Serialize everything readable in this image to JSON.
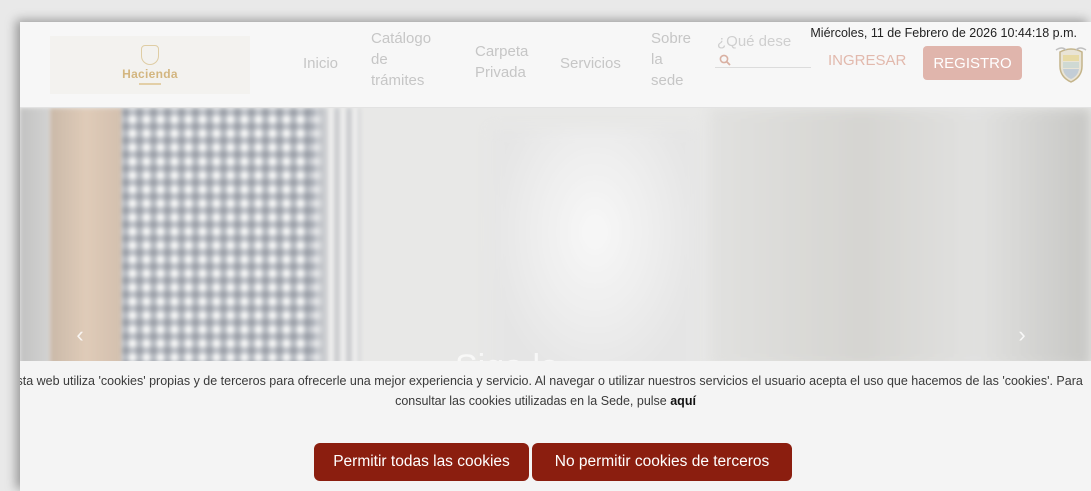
{
  "header": {
    "logo_text": "Hacienda",
    "nav": {
      "inicio": "Inicio",
      "catalogo": [
        "Catálogo",
        "de",
        "trámites"
      ],
      "carpeta": [
        "Carpeta",
        "Privada"
      ],
      "servicios": "Servicios",
      "sobre": [
        "Sobre",
        "la",
        "sede"
      ]
    },
    "search_placeholder": "¿Qué dese",
    "datetime": "Miércoles, 11 de Febrero de 2026 10:44:18 p.m.",
    "ingresar_label": "INGRESAR",
    "registro_label": "REGISTRO"
  },
  "hero": {
    "heading": "Siga la",
    "prev_glyph": "‹",
    "next_glyph": "›"
  },
  "cookies": {
    "text": "Esta web utiliza 'cookies' propias y de terceros para ofrecerle una mejor experiencia y servicio. Al navegar o utilizar nuestros servicios el usuario acepta el uso que hacemos de las 'cookies'. Para consultar las cookies utilizadas en la Sede, pulse",
    "link_label": "aquí",
    "allow_label": "Permitir todas las cookies",
    "deny_label": "No permitir cookies de terceros"
  },
  "colors": {
    "brand_red": "#8b1e0f",
    "registro_bg": "#e0b5ac",
    "logo_gold": "#c9a25b"
  },
  "icons": {
    "search": "search-icon",
    "shield": "coat-of-arms-icon",
    "prev": "chevron-left-icon",
    "next": "chevron-right-icon"
  }
}
